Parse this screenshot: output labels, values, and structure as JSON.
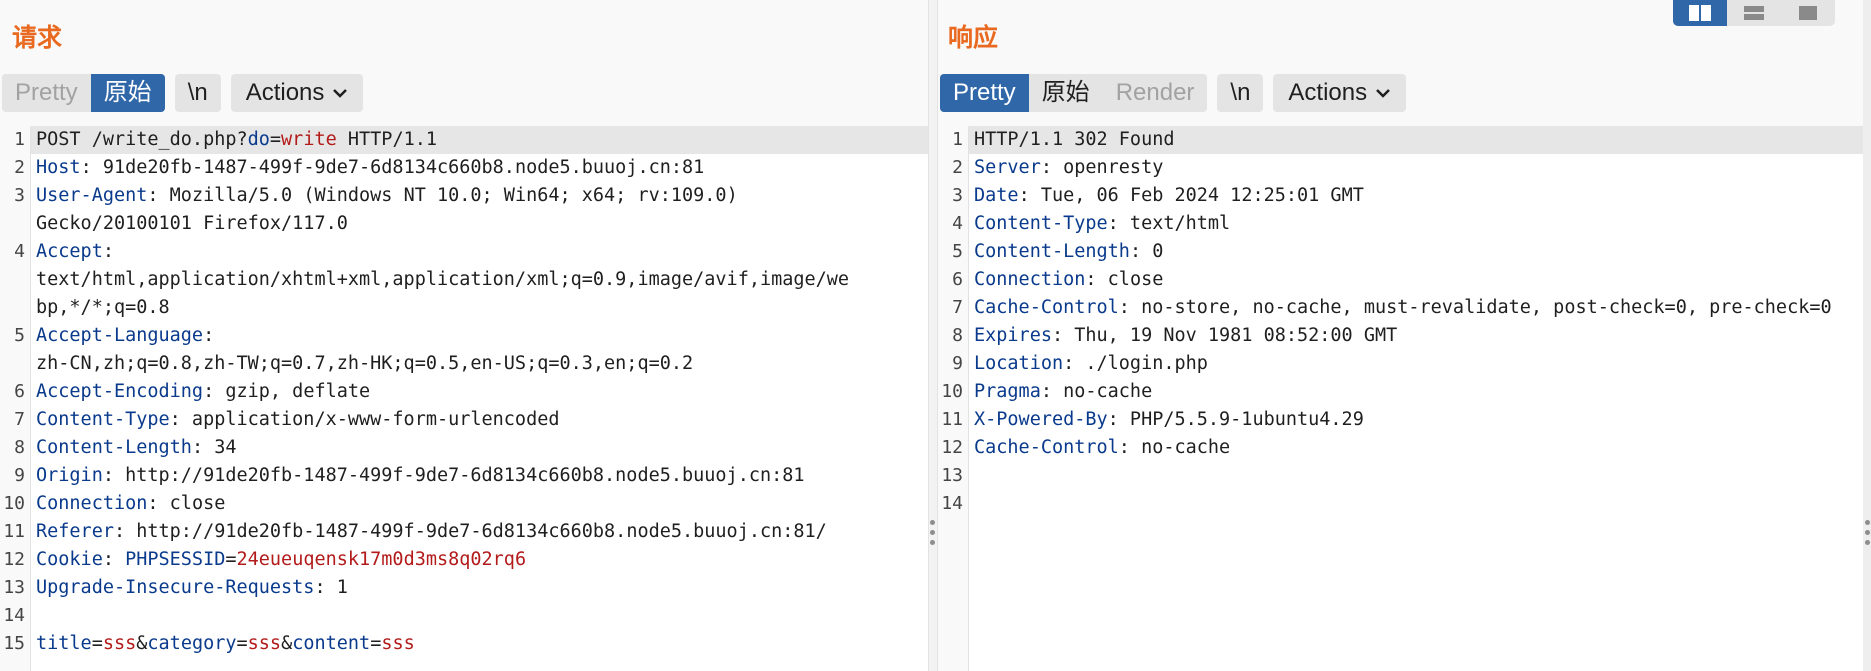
{
  "request": {
    "title": "请求",
    "toolbar": {
      "pretty": "Pretty",
      "raw": "原始",
      "newline": "\\n",
      "actions": "Actions"
    },
    "lines": [
      {
        "n": "1",
        "highlight": true,
        "parts": [
          {
            "t": "POST /write_do.php?",
            "c": "v"
          },
          {
            "t": "do",
            "c": "pn"
          },
          {
            "t": "=",
            "c": "v"
          },
          {
            "t": "write",
            "c": "pv"
          },
          {
            "t": " HTTP/1.1",
            "c": "v"
          }
        ]
      },
      {
        "n": "2",
        "parts": [
          {
            "t": "Host",
            "c": "k"
          },
          {
            "t": ": 91de20fb-1487-499f-9de7-6d8134c660b8.node5.buuoj.cn:81",
            "c": "v"
          }
        ]
      },
      {
        "n": "3",
        "parts": [
          {
            "t": "User-Agent",
            "c": "k"
          },
          {
            "t": ": Mozilla/5.0 (Windows NT 10.0; Win64; x64; rv:109.0)\nGecko/20100101 Firefox/117.0",
            "c": "v"
          }
        ]
      },
      {
        "n": "4",
        "parts": [
          {
            "t": "Accept",
            "c": "k"
          },
          {
            "t": ":\ntext/html,application/xhtml+xml,application/xml;q=0.9,image/avif,image/we\nbp,*/*;q=0.8",
            "c": "v"
          }
        ]
      },
      {
        "n": "5",
        "parts": [
          {
            "t": "Accept-Language",
            "c": "k"
          },
          {
            "t": ":\nzh-CN,zh;q=0.8,zh-TW;q=0.7,zh-HK;q=0.5,en-US;q=0.3,en;q=0.2",
            "c": "v"
          }
        ]
      },
      {
        "n": "6",
        "parts": [
          {
            "t": "Accept-Encoding",
            "c": "k"
          },
          {
            "t": ": gzip, deflate",
            "c": "v"
          }
        ]
      },
      {
        "n": "7",
        "parts": [
          {
            "t": "Content-Type",
            "c": "k"
          },
          {
            "t": ": application/x-www-form-urlencoded",
            "c": "v"
          }
        ]
      },
      {
        "n": "8",
        "parts": [
          {
            "t": "Content-Length",
            "c": "k"
          },
          {
            "t": ": 34",
            "c": "v"
          }
        ]
      },
      {
        "n": "9",
        "parts": [
          {
            "t": "Origin",
            "c": "k"
          },
          {
            "t": ": http://91de20fb-1487-499f-9de7-6d8134c660b8.node5.buuoj.cn:81",
            "c": "v"
          }
        ]
      },
      {
        "n": "10",
        "parts": [
          {
            "t": "Connection",
            "c": "k"
          },
          {
            "t": ": close",
            "c": "v"
          }
        ]
      },
      {
        "n": "11",
        "parts": [
          {
            "t": "Referer",
            "c": "k"
          },
          {
            "t": ": http://91de20fb-1487-499f-9de7-6d8134c660b8.node5.buuoj.cn:81/",
            "c": "v"
          }
        ]
      },
      {
        "n": "12",
        "parts": [
          {
            "t": "Cookie",
            "c": "k"
          },
          {
            "t": ": ",
            "c": "v"
          },
          {
            "t": "PHPSESSID",
            "c": "pn"
          },
          {
            "t": "=",
            "c": "v"
          },
          {
            "t": "24eueuqensk17m0d3ms8q02rq6",
            "c": "pv"
          }
        ]
      },
      {
        "n": "13",
        "parts": [
          {
            "t": "Upgrade-Insecure-Requests",
            "c": "k"
          },
          {
            "t": ": 1",
            "c": "v"
          }
        ]
      },
      {
        "n": "14",
        "parts": [
          {
            "t": "",
            "c": "v"
          }
        ]
      },
      {
        "n": "15",
        "parts": [
          {
            "t": "title",
            "c": "pn"
          },
          {
            "t": "=",
            "c": "v"
          },
          {
            "t": "sss",
            "c": "pv"
          },
          {
            "t": "&",
            "c": "v"
          },
          {
            "t": "category",
            "c": "pn"
          },
          {
            "t": "=",
            "c": "v"
          },
          {
            "t": "sss",
            "c": "pv"
          },
          {
            "t": "&",
            "c": "v"
          },
          {
            "t": "content",
            "c": "pn"
          },
          {
            "t": "=",
            "c": "v"
          },
          {
            "t": "sss",
            "c": "pv"
          }
        ]
      }
    ]
  },
  "response": {
    "title": "响应",
    "toolbar": {
      "pretty": "Pretty",
      "raw": "原始",
      "render": "Render",
      "newline": "\\n",
      "actions": "Actions"
    },
    "lines": [
      {
        "n": "1",
        "highlight": true,
        "parts": [
          {
            "t": "HTTP/1.1 302 Found",
            "c": "v"
          }
        ]
      },
      {
        "n": "2",
        "parts": [
          {
            "t": "Server",
            "c": "k"
          },
          {
            "t": ": openresty",
            "c": "v"
          }
        ]
      },
      {
        "n": "3",
        "parts": [
          {
            "t": "Date",
            "c": "k"
          },
          {
            "t": ": Tue, 06 Feb 2024 12:25:01 GMT",
            "c": "v"
          }
        ]
      },
      {
        "n": "4",
        "parts": [
          {
            "t": "Content-Type",
            "c": "k"
          },
          {
            "t": ": text/html",
            "c": "v"
          }
        ]
      },
      {
        "n": "5",
        "parts": [
          {
            "t": "Content-Length",
            "c": "k"
          },
          {
            "t": ": 0",
            "c": "v"
          }
        ]
      },
      {
        "n": "6",
        "parts": [
          {
            "t": "Connection",
            "c": "k"
          },
          {
            "t": ": close",
            "c": "v"
          }
        ]
      },
      {
        "n": "7",
        "parts": [
          {
            "t": "Cache-Control",
            "c": "k"
          },
          {
            "t": ": no-store, no-cache, must-revalidate, post-check=0, pre-check=0",
            "c": "v"
          }
        ]
      },
      {
        "n": "8",
        "parts": [
          {
            "t": "Expires",
            "c": "k"
          },
          {
            "t": ": Thu, 19 Nov 1981 08:52:00 GMT",
            "c": "v"
          }
        ]
      },
      {
        "n": "9",
        "parts": [
          {
            "t": "Location",
            "c": "k"
          },
          {
            "t": ": ./login.php",
            "c": "v"
          }
        ]
      },
      {
        "n": "10",
        "parts": [
          {
            "t": "Pragma",
            "c": "k"
          },
          {
            "t": ": no-cache",
            "c": "v"
          }
        ]
      },
      {
        "n": "11",
        "parts": [
          {
            "t": "X-Powered-By",
            "c": "k"
          },
          {
            "t": ": PHP/5.5.9-1ubuntu4.29",
            "c": "v"
          }
        ]
      },
      {
        "n": "12",
        "parts": [
          {
            "t": "Cache-Control",
            "c": "k"
          },
          {
            "t": ": no-cache",
            "c": "v"
          }
        ]
      },
      {
        "n": "13",
        "parts": [
          {
            "t": "",
            "c": "v"
          }
        ]
      },
      {
        "n": "14",
        "parts": [
          {
            "t": "",
            "c": "v"
          }
        ]
      }
    ]
  },
  "view_toggle": {
    "options": [
      {
        "icon": "split-columns-icon",
        "active": true
      },
      {
        "icon": "split-rows-icon",
        "active": false
      },
      {
        "icon": "single-pane-icon",
        "active": false
      }
    ]
  },
  "colors": {
    "title": "#e8691f",
    "accent": "#2f67a8",
    "header_name": "#0a3a8c",
    "param_value": "#b31b1b"
  }
}
